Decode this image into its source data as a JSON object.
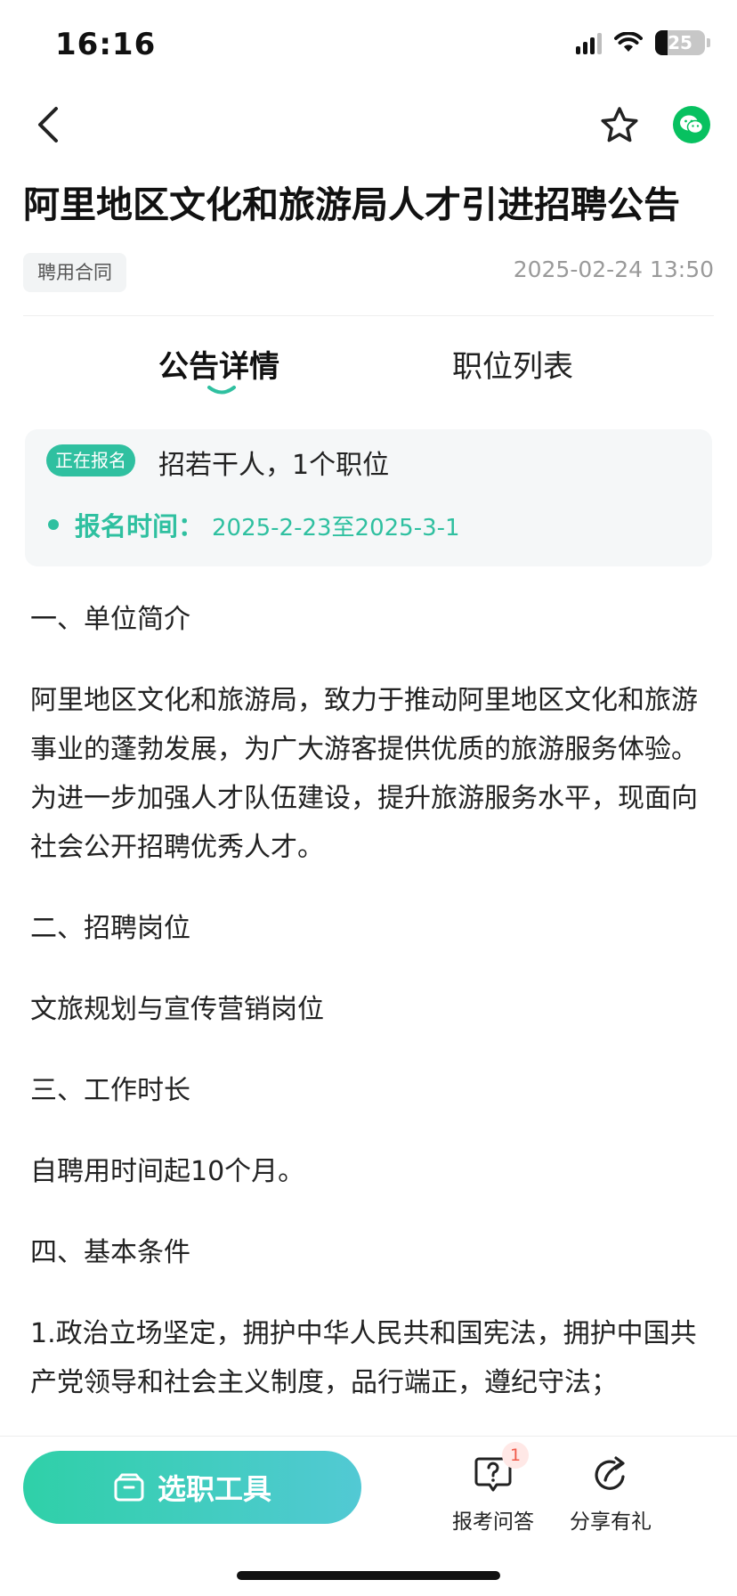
{
  "status_bar": {
    "time": "16:16",
    "battery": "25"
  },
  "article_header": {
    "title": "阿里地区文化和旅游局人才引进招聘公告",
    "tag": "聘用合同",
    "publish_time": "2025-02-24 13:50"
  },
  "tabs": [
    {
      "label": "公告详情",
      "active": true
    },
    {
      "label": "职位列表",
      "active": false
    }
  ],
  "info_card": {
    "status_badge": "正在报名",
    "summary": "招若干人，1个职位",
    "registration_label": "报名时间：",
    "registration_value": "2025-2-23至2025-3-1"
  },
  "article": {
    "paragraphs": [
      "一、单位简介",
      "阿里地区文化和旅游局，致力于推动阿里地区文化和旅游事业的蓬勃发展，为广大游客提供优质的旅游服务体验。为进一步加强人才队伍建设，提升旅游服务水平，现面向社会公开招聘优秀人才。",
      "二、招聘岗位",
      "文旅规划与宣传营销岗位",
      "三、工作时长",
      "自聘用时间起10个月。",
      "四、基本条件",
      "1.政治立场坚定，拥护中华人民共和国宪法，拥护中国共产党领导和社会主义制度，品行端正，遵纪守法；"
    ]
  },
  "bottom_bar": {
    "tool_button": "选职工具",
    "qa": {
      "label": "报考问答",
      "count": "1"
    },
    "share": {
      "label": "分享有礼"
    }
  },
  "colors": {
    "accent": "#2fc0a0",
    "wechat": "#07c160",
    "badge_red": "#f05a4a"
  },
  "icons": [
    "back-icon",
    "star-icon",
    "wechat-icon",
    "box-icon",
    "question-icon",
    "share-icon",
    "wifi-icon",
    "signal-icon",
    "battery-icon"
  ]
}
